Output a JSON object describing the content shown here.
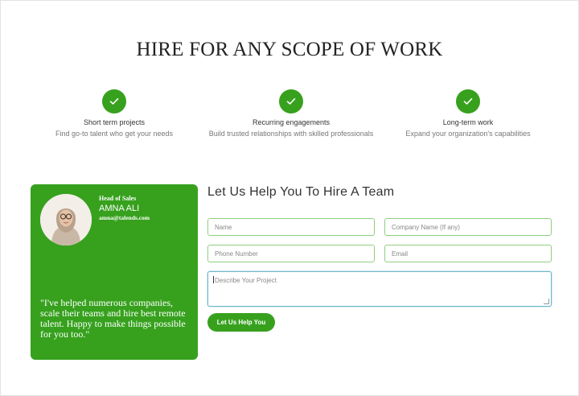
{
  "page": {
    "title": "HIRE FOR ANY SCOPE OF WORK"
  },
  "features": [
    {
      "title": "Short term projects",
      "desc": "Find go-to talent who get your needs",
      "icon": "check-icon"
    },
    {
      "title": "Recurring engagements",
      "desc": "Build trusted relationships with skilled professionals",
      "icon": "check-icon"
    },
    {
      "title": "Long-term work",
      "desc": "Expand your organization's capabilities",
      "icon": "check-icon"
    }
  ],
  "testimonial": {
    "role": "Head of Sales",
    "name": "AMNA ALI",
    "email": "amna@talends.com",
    "quote": "\"I've helped numerous companies, scale their teams and hire best remote talent. Happy to make things possible for you too.\""
  },
  "form": {
    "title": "Let Us Help You To Hire A Team",
    "name_placeholder": "Name",
    "company_placeholder": "Company Name (If any)",
    "phone_placeholder": "Phone Number",
    "email_placeholder": "Email",
    "project_placeholder": "Describe Your Project",
    "submit_label": "Let Us Help You"
  },
  "colors": {
    "accent": "#37a11e",
    "field_border": "#8fcf80"
  }
}
